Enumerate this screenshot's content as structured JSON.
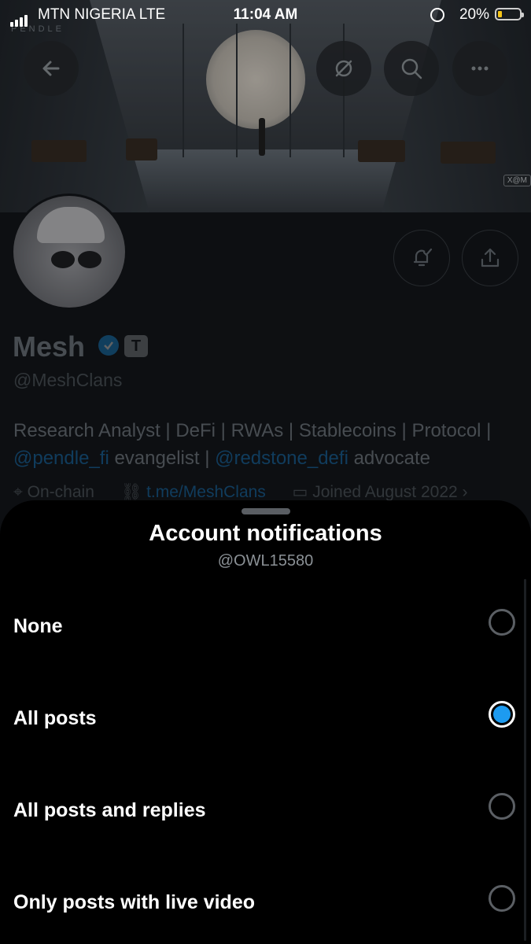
{
  "status_bar": {
    "carrier": "MTN NIGERIA  LTE",
    "time": "11:04 AM",
    "battery_percent": "20%",
    "battery_level": 0.2,
    "battery_color": "#f5c518"
  },
  "banner": {
    "brand_text": "PENDLE",
    "watermark": "X@M"
  },
  "header_icons": {
    "back": "arrow-left-icon",
    "grok": "slash-circle-icon",
    "search": "search-icon",
    "more": "more-icon"
  },
  "profile": {
    "name": "Mesh",
    "handle": "@MeshClans",
    "bio_line1": "Research Analyst | DeFi | RWAs | Stablecoins | Protocol |",
    "bio_mention1": "@pendle_fi",
    "bio_text2": " evangelist | ",
    "bio_mention2": "@redstone_defi",
    "bio_text3": " advocate",
    "location": "On-chain",
    "link": "t.me/MeshClans",
    "joined": "Joined August 2022",
    "affiliate_badge": "T",
    "link_color": "#1d9bf0"
  },
  "sheet": {
    "title": "Account notifications",
    "subtitle": "@OWL15580",
    "options": [
      {
        "label": "None",
        "selected": false
      },
      {
        "label": "All posts",
        "selected": true
      },
      {
        "label": "All posts and replies",
        "selected": false
      },
      {
        "label": "Only posts with live video",
        "selected": false
      }
    ],
    "accent": "#1d9bf0"
  }
}
